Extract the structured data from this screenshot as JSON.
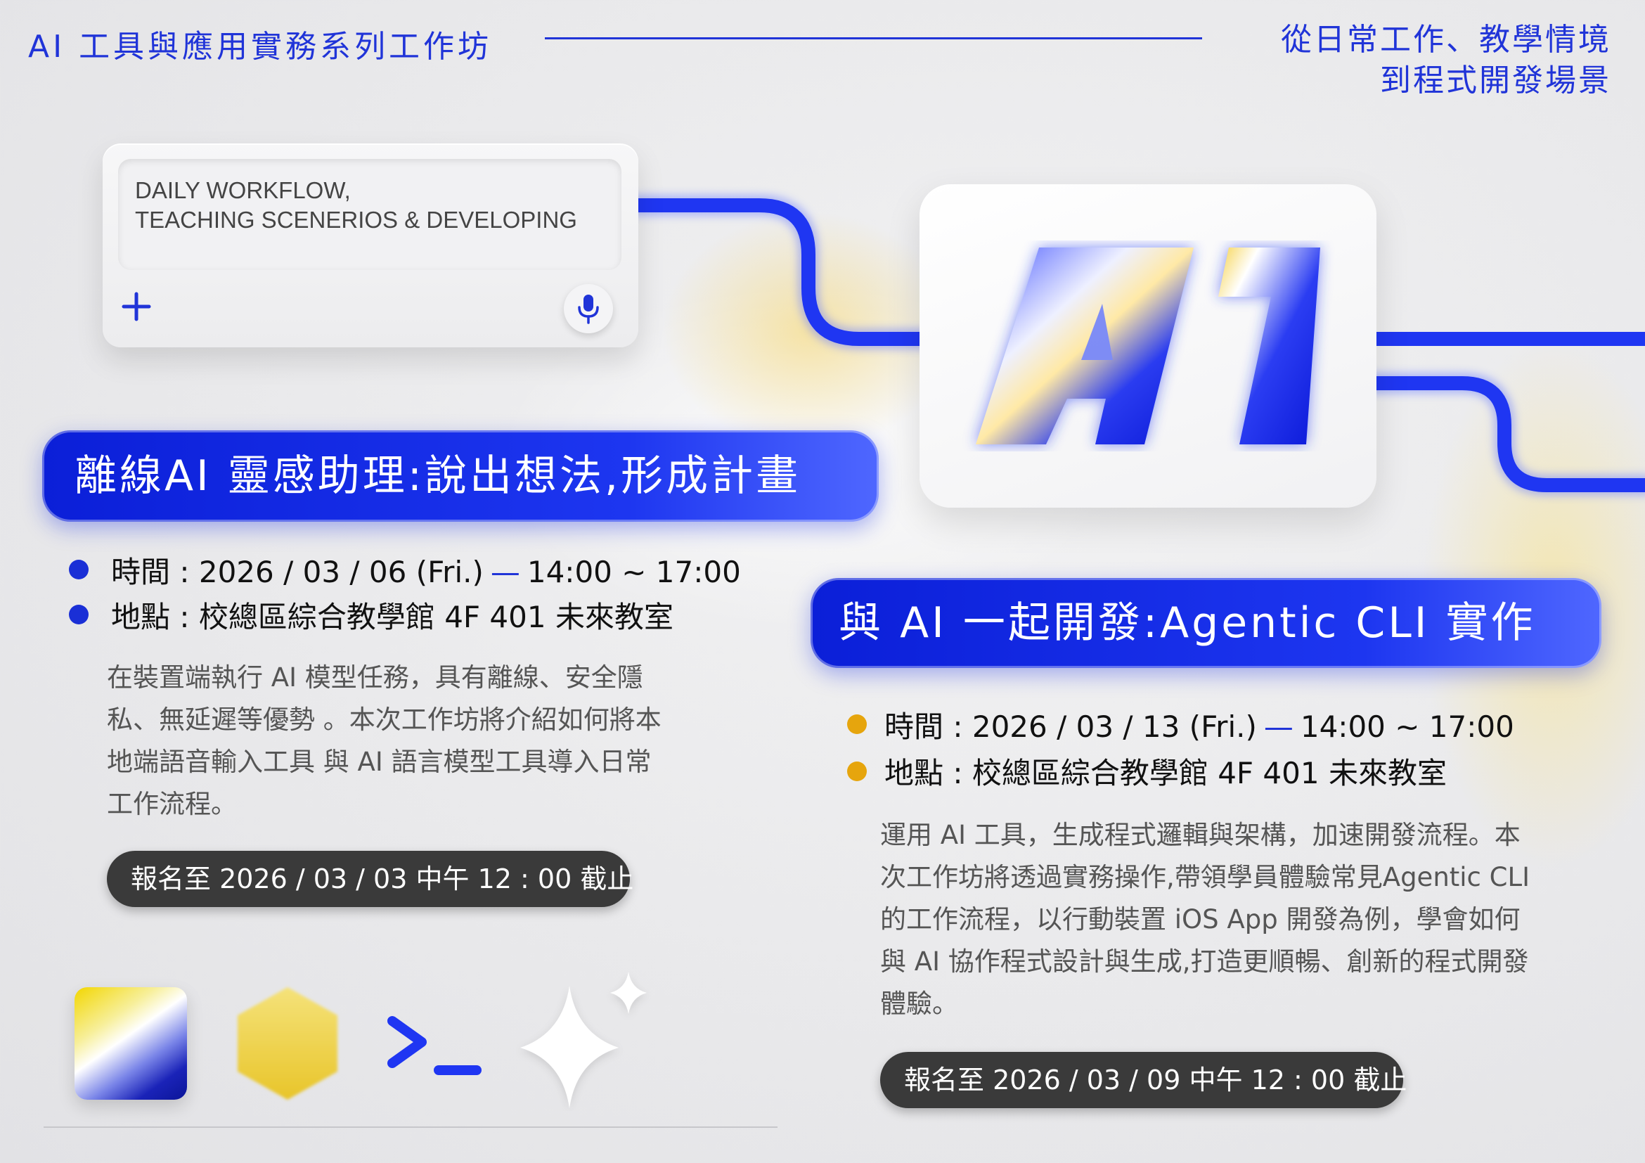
{
  "header": {
    "series_title": "AI 工具與應用實務系列工作坊",
    "subtitle_line1": "從日常工作、教學情境",
    "subtitle_line2": "到程式開發場景"
  },
  "prompt_card": {
    "text_line1": "DAILY WORKFLOW,",
    "text_line2": "TEACHING SCENERIOS & DEVELOPING",
    "icons": [
      "plus-icon",
      "microphone-icon"
    ]
  },
  "logo": {
    "text": "AI"
  },
  "session1": {
    "title": "離線AI 靈感助理:說出想法,形成計畫",
    "time_label": "時間 : ",
    "time_date": "2026 / 03 / 06  (Fri.)",
    "time_dash": "—",
    "time_hours": "14:00 ~ 17:00",
    "place": "地點 : 校總區綜合教學館 4F 401 未來教室",
    "description": "在裝置端執行 AI 模型任務，具有離線、安全隱私、無延遲等優勢 。本次工作坊將介紹如何將本地端語音輸入工具 與 AI 語言模型工具導入日常工作流程。",
    "deadline": "報名至 2026 / 03 / 03  中午 12 : 00 截止"
  },
  "session2": {
    "title": "與 AI 一起開發:Agentic CLI 實作",
    "time_label": "時間 : ",
    "time_date": "2026 / 03 / 13  (Fri.)",
    "time_dash": "—",
    "time_hours": "14:00 ~ 17:00",
    "place": "地點 : 校總區綜合教學館 4F 401 未來教室",
    "description": "運用 AI 工具，生成程式邏輯與架構，加速開發流程。本次工作坊將透過實務操作,帶領學員體驗常見Agentic CLI 的工作流程，以行動裝置 iOS App 開發為例，學會如何與 AI 協作程式設計與生成,打造更順暢、創新的程式開發體驗。",
    "deadline": "報名至 2026 / 03 / 09  中午 12 : 00 截止"
  },
  "bottom_icons": [
    "gradient-square-icon",
    "hexagon-icon",
    "terminal-prompt-icon",
    "sparkle-icon"
  ],
  "colors": {
    "accent_blue": "#1a2fd6",
    "accent_gold": "#e6a50d",
    "background": "#e9e9eb",
    "deadline_pill": "#3a3a3a"
  }
}
